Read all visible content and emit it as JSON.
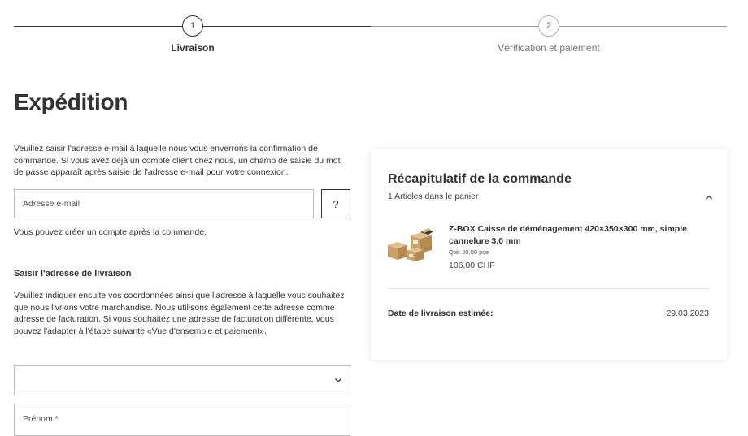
{
  "progress": {
    "steps": [
      {
        "number": "1",
        "label": "Livraison"
      },
      {
        "number": "2",
        "label": "Vérification et paiement"
      }
    ],
    "current_step": 1
  },
  "page_title": "Expédition",
  "intro_text": "Veuillez saisir l'adresse e-mail à laquelle nous vous enverrons la confirmation de commande. Si vous avez déjà un compte client chez nous, un champ de saisie du mot de passe apparaît après saisie de l'adresse e-mail pour votre connexion.",
  "email": {
    "placeholder": "Adresse e-mail",
    "value": "",
    "help_label": "?"
  },
  "account_note": "Vous pouvez créer un compte après la commande.",
  "address_section": {
    "heading": "Saisir l'adresse de livraison",
    "text": "Veuillez indiquer ensuite vos coordonnées ainsi que l'adresse à laquelle vous souhaitez que nous livrions votre marchandise. Nous utilisons également cette adresse comme adresse de facturation. Si vous souhaitez une adresse de facturation différente, vous pouvez l'adapter à l'étape suivante «Vue d'ensemble et paiement».",
    "salutation_value": "",
    "firstname_placeholder": "Prénom *"
  },
  "summary": {
    "title": "Récapitulatif de la commande",
    "count_text": "1 Articles dans le panier",
    "product": {
      "name": "Z-BOX Caisse de déménagement 420×350×300 mm, simple cannelure 3,0 mm",
      "qty": "Qté: 20,00 pce",
      "price": "106,00 CHF",
      "image_icon": "moving-boxes-image"
    },
    "delivery_label": "Date de livraison estimée:",
    "delivery_date": "29.03.2023"
  },
  "colors": {
    "text": "#333333",
    "border": "#bdbdbd",
    "box": "#c9a26a"
  }
}
